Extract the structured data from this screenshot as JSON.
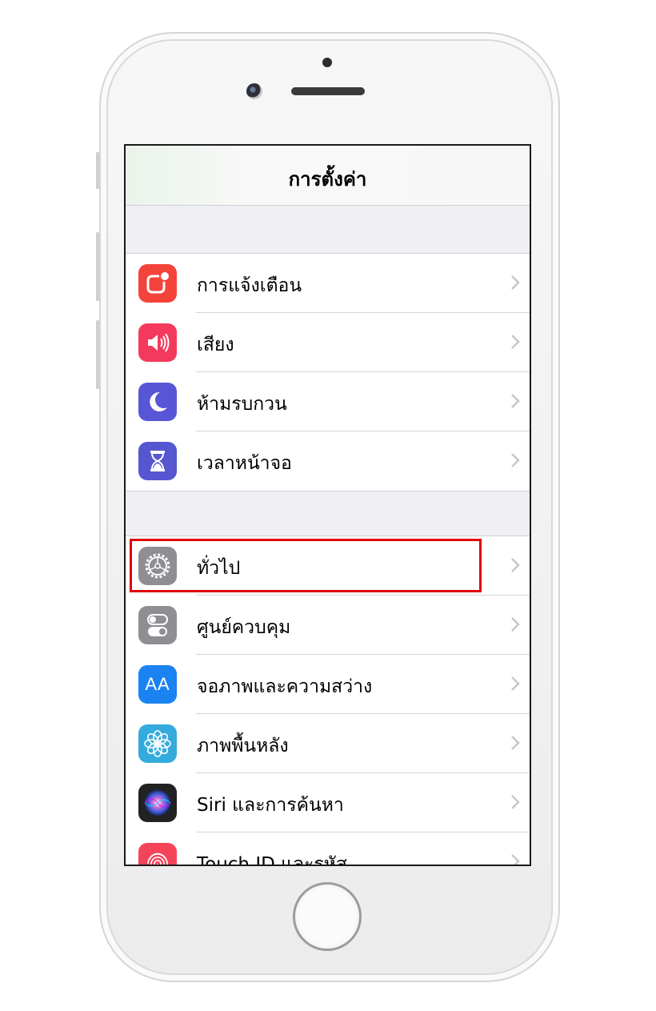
{
  "screen": {
    "title": "การตั้งค่า"
  },
  "group1": [
    {
      "label": "การแจ้งเตือน",
      "icon": "notifications-icon",
      "color": "#f4433b"
    },
    {
      "label": "เสียง",
      "icon": "sound-icon",
      "color": "#f43a5c"
    },
    {
      "label": "ห้ามรบกวน",
      "icon": "moon-icon",
      "color": "#5856d6"
    },
    {
      "label": "เวลาหน้าจอ",
      "icon": "hourglass-icon",
      "color": "#5656d0"
    }
  ],
  "group2": [
    {
      "label": "ทั่วไป",
      "icon": "gear-icon",
      "color": "#8e8e93"
    },
    {
      "label": "ศูนย์ควบคุม",
      "icon": "switches-icon",
      "color": "#8e8e93"
    },
    {
      "label": "จอภาพและความสว่าง",
      "icon": "display-text-icon",
      "color": "#1b82f2",
      "icon_text": "AA"
    },
    {
      "label": "ภาพพื้นหลัง",
      "icon": "flower-icon",
      "color": "#35aadc"
    },
    {
      "label": "Siri และการค้นหา",
      "icon": "siri-icon",
      "color": "#222222"
    },
    {
      "label": "Touch ID และรหัส",
      "icon": "fingerprint-icon",
      "color": "#f4445a"
    }
  ],
  "annotation": {
    "color": "#e00000",
    "target": "ทั่วไป"
  }
}
